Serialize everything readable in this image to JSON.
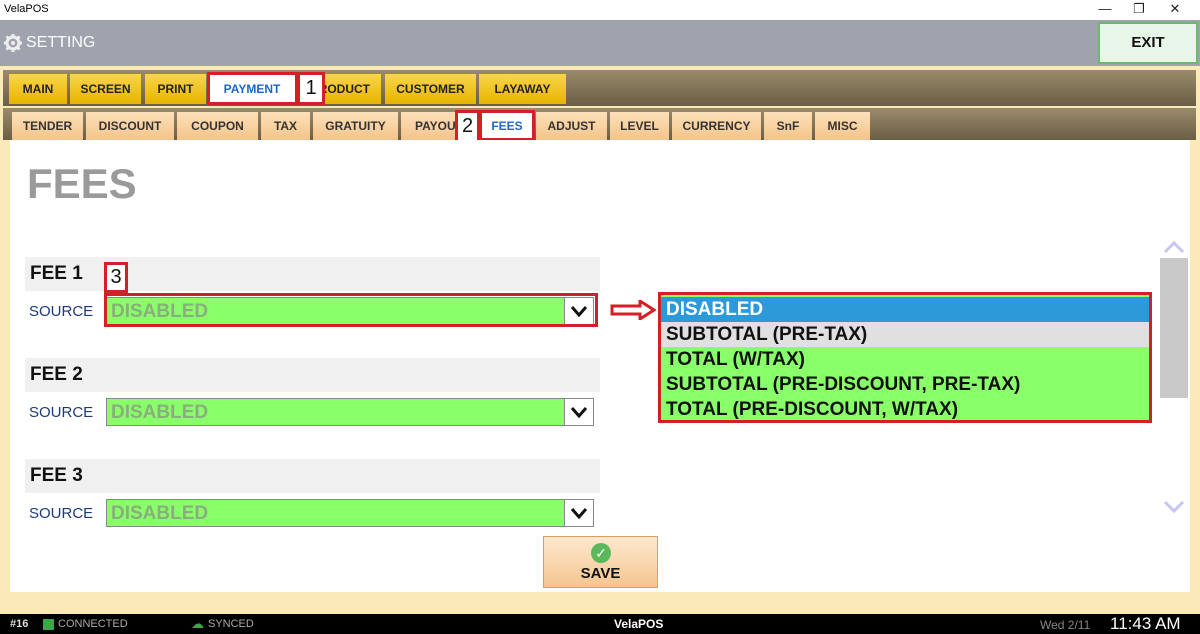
{
  "window": {
    "title": "VelaPOS",
    "min": "—",
    "restore": "❐",
    "close": "✕"
  },
  "header": {
    "setting_label": "SETTING",
    "exit_label": "EXIT"
  },
  "tabs_main": [
    {
      "label": "MAIN"
    },
    {
      "label": "SCREEN"
    },
    {
      "label": "PRINT"
    },
    {
      "label": "PAYMENT"
    },
    {
      "label": "PRODUCT"
    },
    {
      "label": "CUSTOMER"
    },
    {
      "label": "LAYAWAY"
    }
  ],
  "tabs_sub": [
    {
      "label": "TENDER"
    },
    {
      "label": "DISCOUNT"
    },
    {
      "label": "COUPON"
    },
    {
      "label": "TAX"
    },
    {
      "label": "GRATUITY"
    },
    {
      "label": "PAYOUT"
    },
    {
      "label": "FEES"
    },
    {
      "label": "ADJUST"
    },
    {
      "label": "LEVEL"
    },
    {
      "label": "CURRENCY"
    },
    {
      "label": "SnF"
    },
    {
      "label": "MISC"
    }
  ],
  "page_title": "FEES",
  "fees": [
    {
      "title": "FEE 1",
      "source_label": "SOURCE",
      "value": "DISABLED"
    },
    {
      "title": "FEE 2",
      "source_label": "SOURCE",
      "value": "DISABLED"
    },
    {
      "title": "FEE 3",
      "source_label": "SOURCE",
      "value": "DISABLED"
    }
  ],
  "dropdown_options": [
    "DISABLED",
    "SUBTOTAL (PRE-TAX)",
    "TOTAL (W/TAX)",
    "SUBTOTAL (PRE-DISCOUNT, PRE-TAX)",
    "TOTAL (PRE-DISCOUNT, W/TAX)"
  ],
  "annotations": {
    "step1": "1",
    "step2": "2",
    "step3": "3"
  },
  "save_label": "SAVE",
  "status": {
    "station": "#16",
    "connected": "CONNECTED",
    "synced": "SYNCED",
    "brand": "VelaPOS",
    "date": "Wed 2/11",
    "time": "11:43 AM"
  },
  "colors": {
    "accent_red": "#d32027",
    "select_green": "#89ff6a",
    "selected_blue": "#2c9ad8"
  }
}
